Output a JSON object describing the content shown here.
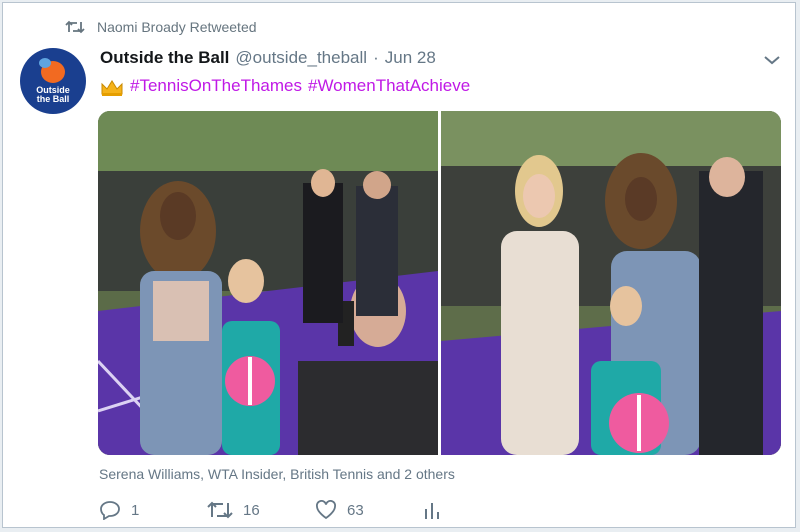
{
  "retweet": {
    "text": "Naomi Broady Retweeted"
  },
  "avatar": {
    "line1": "Outside",
    "line2": "the Ball"
  },
  "tweet": {
    "display_name": "Outside the Ball",
    "handle": "@outside_theball",
    "separator": "·",
    "date": "Jun 28",
    "hashtags": [
      "#TennisOnTheThames",
      "#WomenThatAchieve"
    ]
  },
  "photos": [
    {
      "name": "photo-left"
    },
    {
      "name": "photo-right"
    }
  ],
  "tagged": "Serena Williams, WTA Insider, British Tennis and 2 others",
  "actions": {
    "replies": "1",
    "retweets": "16",
    "likes": "63"
  },
  "colors": {
    "hashtag": "#c019e6",
    "muted": "#657786",
    "avatar_bg": "#1a3f8f",
    "ball": "#f26a21"
  },
  "icons": [
    "retweet-icon",
    "chevron-down-icon",
    "crown-icon",
    "reply-icon",
    "like-icon",
    "analytics-icon"
  ]
}
